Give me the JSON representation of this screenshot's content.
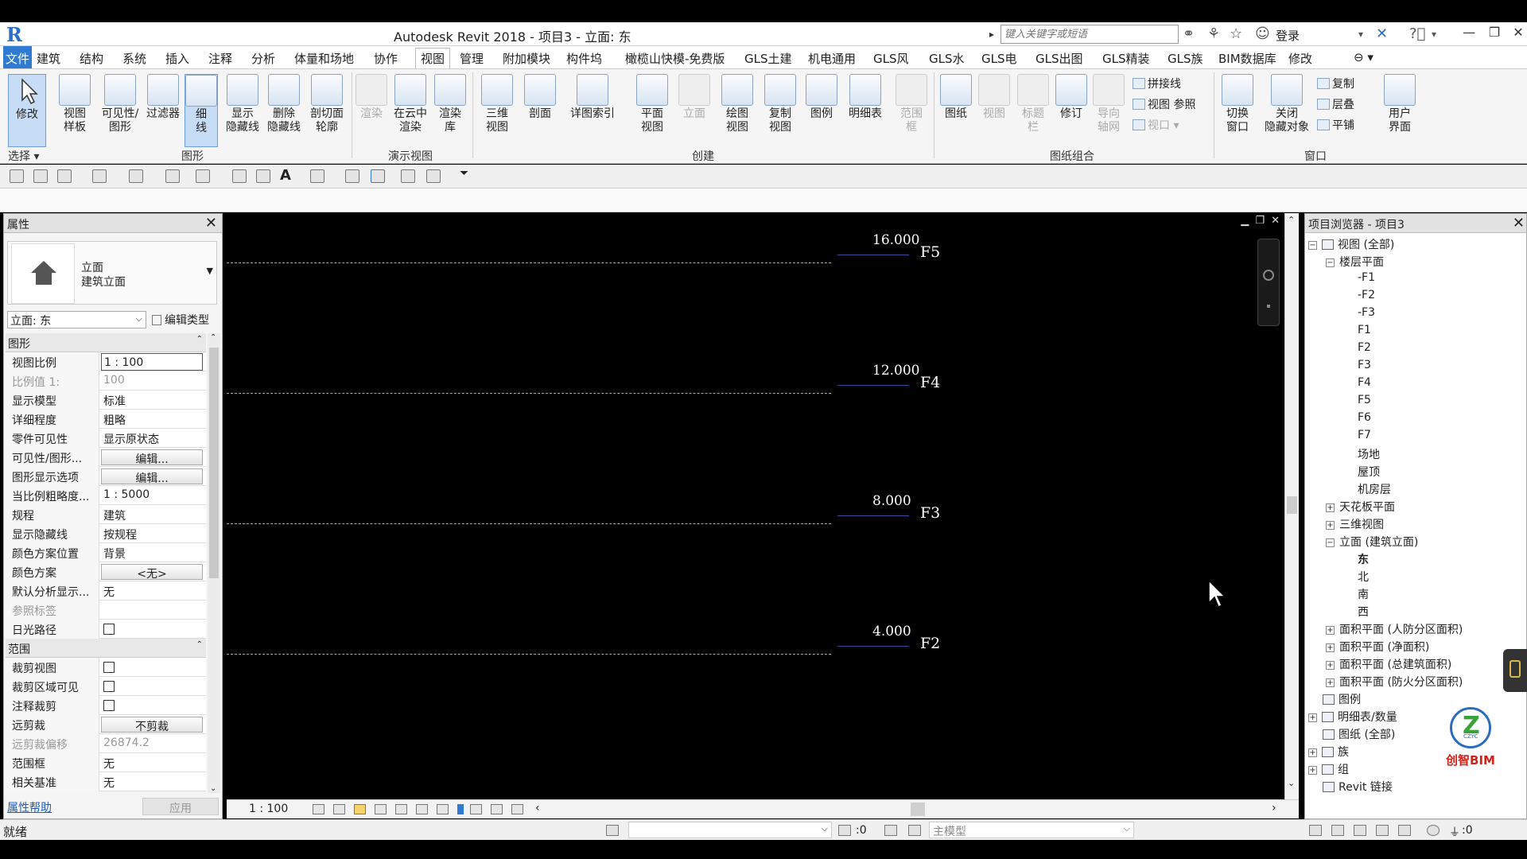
{
  "titlebar": {
    "app_title": "Autodesk Revit 2018 -    项目3 - 立面: 东",
    "search_placeholder": "键入关键字或短语",
    "login": "登录"
  },
  "menu": {
    "tabs": [
      "文件",
      "建筑",
      "结构",
      "系统",
      "插入",
      "注释",
      "分析",
      "体量和场地",
      "协作",
      "视图",
      "管理",
      "附加模块",
      "构件坞",
      "橄榄山快模-免费版",
      "GLS土建",
      "机电通用",
      "GLS风",
      "GLS水",
      "GLS电",
      "GLS出图",
      "GLS精装",
      "GLS族",
      "BIM数据库",
      "修改"
    ],
    "active": "视图"
  },
  "ribbon": {
    "buttons": {
      "modify": "修改",
      "view_template": "视图\n样板",
      "visibility": "可见性/\n图形",
      "filter": "过滤器",
      "thin_lines": "细\n线",
      "show_hidden": "显示\n隐藏线",
      "remove_hidden": "删除\n隐藏线",
      "cut_profile": "剖切面\n轮廓",
      "render": "渲染",
      "cloud_render": "在云中\n渲染",
      "render_gallery": "渲染\n库",
      "three_d": "三维\n视图",
      "section": "剖面",
      "callout": "详图索引",
      "plan_views": "平面\n视图",
      "elevation": "立面",
      "drafting": "绘图\n视图",
      "duplicate": "复制\n视图",
      "legend": "图例",
      "schedules": "明细表",
      "scope_box": "范围\n框",
      "sheet": "图纸",
      "view": "视图",
      "title_block": "标题\n栏",
      "revision": "修订",
      "guide_grid": "导向\n轴网",
      "switch_window": "切换\n窗口",
      "close_hidden": "关闭\n隐藏对象",
      "user_interface": "用户\n界面"
    },
    "small": {
      "matchline": "拼接线",
      "view_ref": "视图 参照",
      "viewport": "视口",
      "replicate": "复制",
      "cascade": "层叠",
      "tile": "平铺"
    },
    "groups": {
      "select": "选择",
      "graphics": "图形",
      "presentation": "演示视图",
      "create": "创建",
      "sheet_comp": "图纸组合",
      "windows": "窗口"
    }
  },
  "properties": {
    "title": "属性",
    "type_name1": "立面",
    "type_name2": "建筑立面",
    "view_selector": "立面: 东",
    "edit_type": "编辑类型",
    "sections": [
      {
        "name": "图形",
        "rows": [
          {
            "name": "视图比例",
            "value": "1 : 100",
            "kind": "boxed"
          },
          {
            "name": "比例值 1:",
            "value": "100",
            "kind": "gray"
          },
          {
            "name": "显示模型",
            "value": "标准"
          },
          {
            "name": "详细程度",
            "value": "粗略"
          },
          {
            "name": "零件可见性",
            "value": "显示原状态"
          },
          {
            "name": "可见性/图形...",
            "value": "编辑...",
            "kind": "btn"
          },
          {
            "name": "图形显示选项",
            "value": "编辑...",
            "kind": "btn"
          },
          {
            "name": "当比例粗略度...",
            "value": "1 : 5000"
          },
          {
            "name": "规程",
            "value": "建筑"
          },
          {
            "name": "显示隐藏线",
            "value": "按规程"
          },
          {
            "name": "颜色方案位置",
            "value": "背景"
          },
          {
            "name": "颜色方案",
            "value": "<无>",
            "kind": "btn"
          },
          {
            "name": "默认分析显示...",
            "value": "无"
          },
          {
            "name": "参照标签",
            "value": "",
            "kind": "gray"
          },
          {
            "name": "日光路径",
            "value": "",
            "kind": "check"
          }
        ]
      },
      {
        "name": "范围",
        "rows": [
          {
            "name": "裁剪视图",
            "value": "",
            "kind": "check"
          },
          {
            "name": "裁剪区域可见",
            "value": "",
            "kind": "check"
          },
          {
            "name": "注释裁剪",
            "value": "",
            "kind": "check"
          },
          {
            "name": "远剪裁",
            "value": "不剪裁",
            "kind": "btn"
          },
          {
            "name": "远剪裁偏移",
            "value": "26874.2",
            "kind": "gray"
          },
          {
            "name": "范围框",
            "value": "无"
          },
          {
            "name": "相关基准",
            "value": "无"
          }
        ]
      }
    ],
    "help": "属性帮助",
    "apply": "应用"
  },
  "canvas": {
    "levels": [
      {
        "name": "F5",
        "elevation": "16.000"
      },
      {
        "name": "F4",
        "elevation": "12.000"
      },
      {
        "name": "F3",
        "elevation": "8.000"
      },
      {
        "name": "F2",
        "elevation": "4.000"
      }
    ],
    "scale": "1 : 100"
  },
  "browser": {
    "title": "项目浏览器 - 项目3",
    "nodes": [
      {
        "label": "视图 (全部)",
        "lvl": 0,
        "exp": "-",
        "icon": true
      },
      {
        "label": "楼层平面",
        "lvl": 1,
        "exp": "-"
      },
      {
        "label": "-F1",
        "lvl": 2
      },
      {
        "label": "-F2",
        "lvl": 2
      },
      {
        "label": "-F3",
        "lvl": 2
      },
      {
        "label": "F1",
        "lvl": 2
      },
      {
        "label": "F2",
        "lvl": 2
      },
      {
        "label": "F3",
        "lvl": 2
      },
      {
        "label": "F4",
        "lvl": 2
      },
      {
        "label": "F5",
        "lvl": 2
      },
      {
        "label": "F6",
        "lvl": 2
      },
      {
        "label": "F7",
        "lvl": 2
      },
      {
        "label": "场地",
        "lvl": 2
      },
      {
        "label": "屋顶",
        "lvl": 2
      },
      {
        "label": "机房层",
        "lvl": 2
      },
      {
        "label": "天花板平面",
        "lvl": 1,
        "exp": "+"
      },
      {
        "label": "三维视图",
        "lvl": 1,
        "exp": "+"
      },
      {
        "label": "立面 (建筑立面)",
        "lvl": 1,
        "exp": "-"
      },
      {
        "label": "东",
        "lvl": 2,
        "bold": true
      },
      {
        "label": "北",
        "lvl": 2
      },
      {
        "label": "南",
        "lvl": 2
      },
      {
        "label": "西",
        "lvl": 2
      },
      {
        "label": "面积平面 (人防分区面积)",
        "lvl": 1,
        "exp": "+"
      },
      {
        "label": "面积平面 (净面积)",
        "lvl": 1,
        "exp": "+"
      },
      {
        "label": "面积平面 (总建筑面积)",
        "lvl": 1,
        "exp": "+"
      },
      {
        "label": "面积平面 (防火分区面积)",
        "lvl": 1,
        "exp": "+"
      },
      {
        "label": "图例",
        "lvl": 0,
        "icon": true
      },
      {
        "label": "明细表/数量",
        "lvl": 0,
        "exp": "+",
        "icon": true
      },
      {
        "label": "图纸 (全部)",
        "lvl": 0,
        "icon": true
      },
      {
        "label": "族",
        "lvl": 0,
        "exp": "+",
        "icon": true
      },
      {
        "label": "组",
        "lvl": 0,
        "exp": "+",
        "icon": true
      },
      {
        "label": "Revit 链接",
        "lvl": 0,
        "icon": true
      }
    ],
    "logo_text": "创智BIM",
    "logo_letters": "CZYC"
  },
  "statusbar": {
    "status": "就绪",
    "ws_value": ":0",
    "main_model": "主模型",
    "filter_count": ":0"
  },
  "colors": {
    "accent": "#2f7bd1",
    "canvas_bg": "#000000",
    "level_head": "#3a4d9c"
  }
}
